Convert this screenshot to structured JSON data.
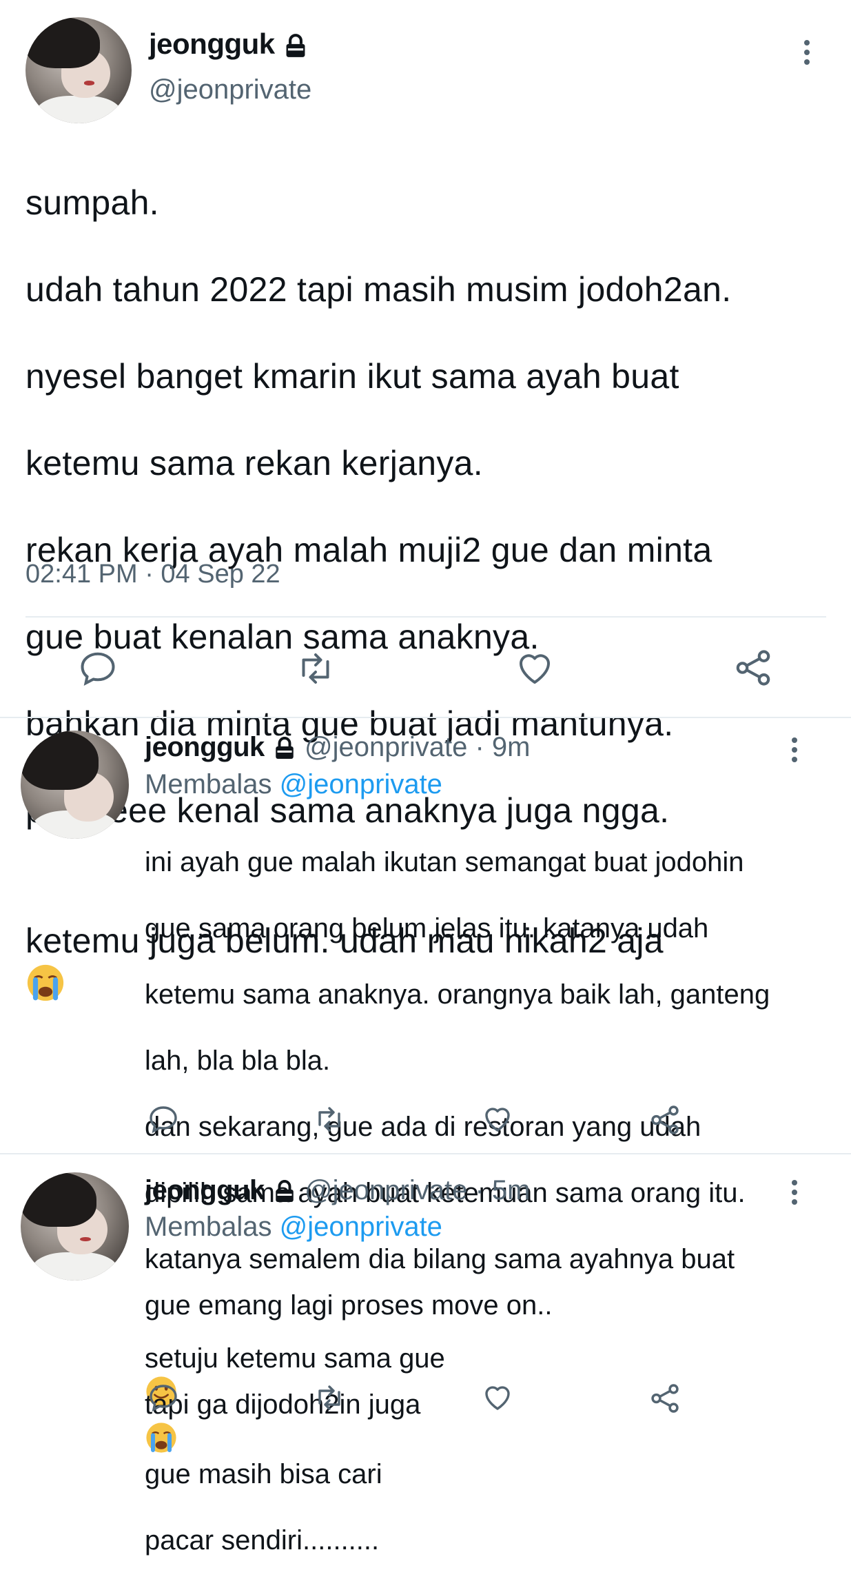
{
  "main_tweet": {
    "author_name": "jeongguk",
    "author_handle": "@jeonprivate",
    "lines": [
      "sumpah.",
      "udah tahun 2022 tapi masih musim jodoh2an.",
      "nyesel banget kmarin ikut sama ayah buat",
      "ketemu sama rekan kerjanya.",
      "rekan kerja ayah malah muji2 gue dan minta",
      "gue buat kenalan sama anaknya.",
      "bahkan dia minta gue buat jadi mantunya.",
      "pleaseee kenal sama anaknya juga ngga.",
      "ketemu juga belum. udah mau nikah2 aja"
    ],
    "timestamp": "02:41 PM · 04 Sep 22"
  },
  "replies": [
    {
      "author_name": "jeongguk",
      "author_handle": "@jeonprivate",
      "age": "· 9m",
      "replying_label": "Membalas",
      "replying_to": "@jeonprivate",
      "lines": [
        "ini ayah gue malah ikutan semangat buat jodohin",
        "gue sama orang belum jelas itu. katanya udah",
        "ketemu sama anaknya. orangnya baik lah, ganteng",
        "lah, bla bla bla.",
        "dan sekarang, gue ada di restoran yang udah",
        "dipilih sama ayah buat ketemuan sama orang itu.",
        "katanya semalem dia bilang sama ayahnya buat",
        "setuju ketemu sama gue"
      ]
    },
    {
      "author_name": "jeongguk",
      "author_handle": "@jeonprivate",
      "age": "· 5m",
      "replying_label": "Membalas",
      "replying_to": "@jeonprivate",
      "line1": "gue emang lagi proses move on..",
      "line2a": "tapi ga dijodoh2in juga",
      "line2b": "gue masih bisa cari",
      "line3": "pacar sendiri.........."
    }
  ],
  "colors": {
    "text": "#0f1419",
    "secondary": "#536471",
    "link": "#1d9bf0",
    "divider": "#e6ecf0"
  },
  "icons": [
    "lock-icon",
    "more-icon",
    "reply-icon",
    "retweet-icon",
    "like-icon",
    "share-icon",
    "crying-emoji",
    "smile-emoji"
  ]
}
